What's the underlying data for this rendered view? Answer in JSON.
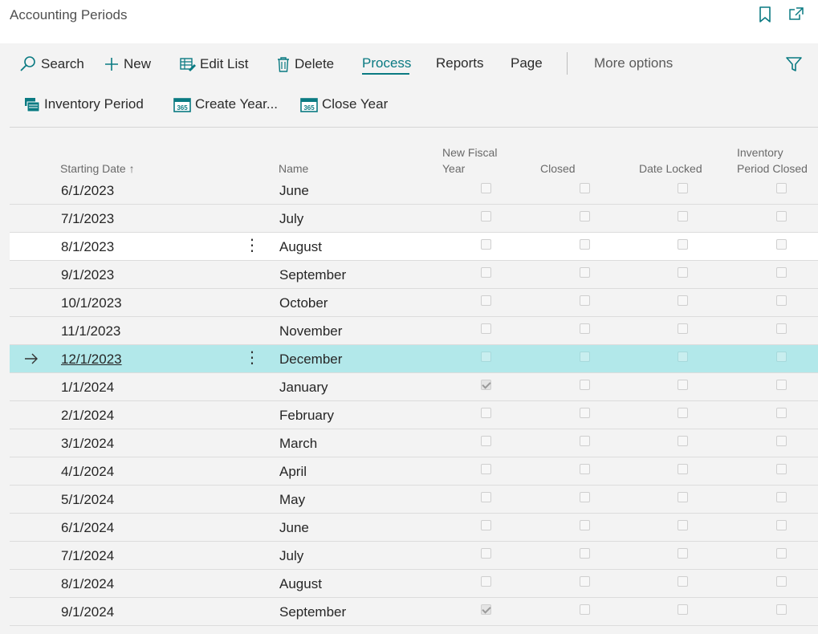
{
  "page": {
    "title": "Accounting Periods"
  },
  "toolbar": {
    "search": "Search",
    "new": "New",
    "edit_list": "Edit List",
    "delete": "Delete",
    "process": "Process",
    "reports": "Reports",
    "page": "Page",
    "more_options": "More options",
    "inventory_period": "Inventory Period",
    "create_year": "Create Year...",
    "close_year": "Close Year"
  },
  "table": {
    "columns": {
      "starting_date": "Starting Date",
      "sort_indicator": "↑",
      "name": "Name",
      "new_fiscal_year_l1": "New Fiscal",
      "new_fiscal_year_l2": "Year",
      "closed": "Closed",
      "date_locked": "Date Locked",
      "inventory_period_closed_l1": "Inventory",
      "inventory_period_closed_l2": "Period Closed"
    },
    "rows": [
      {
        "date": "6/1/2023",
        "name": "June",
        "new_fiscal_year": false,
        "closed": false,
        "date_locked": false,
        "inventory_closed": false
      },
      {
        "date": "7/1/2023",
        "name": "July",
        "new_fiscal_year": false,
        "closed": false,
        "date_locked": false,
        "inventory_closed": false
      },
      {
        "date": "8/1/2023",
        "name": "August",
        "new_fiscal_year": false,
        "closed": false,
        "date_locked": false,
        "inventory_closed": false,
        "hover": true
      },
      {
        "date": "9/1/2023",
        "name": "September",
        "new_fiscal_year": false,
        "closed": false,
        "date_locked": false,
        "inventory_closed": false
      },
      {
        "date": "10/1/2023",
        "name": "October",
        "new_fiscal_year": false,
        "closed": false,
        "date_locked": false,
        "inventory_closed": false
      },
      {
        "date": "11/1/2023",
        "name": "November",
        "new_fiscal_year": false,
        "closed": false,
        "date_locked": false,
        "inventory_closed": false
      },
      {
        "date": "12/1/2023",
        "name": "December",
        "new_fiscal_year": false,
        "closed": false,
        "date_locked": false,
        "inventory_closed": false,
        "selected": true
      },
      {
        "date": "1/1/2024",
        "name": "January",
        "new_fiscal_year": true,
        "closed": false,
        "date_locked": false,
        "inventory_closed": false
      },
      {
        "date": "2/1/2024",
        "name": "February",
        "new_fiscal_year": false,
        "closed": false,
        "date_locked": false,
        "inventory_closed": false
      },
      {
        "date": "3/1/2024",
        "name": "March",
        "new_fiscal_year": false,
        "closed": false,
        "date_locked": false,
        "inventory_closed": false
      },
      {
        "date": "4/1/2024",
        "name": "April",
        "new_fiscal_year": false,
        "closed": false,
        "date_locked": false,
        "inventory_closed": false
      },
      {
        "date": "5/1/2024",
        "name": "May",
        "new_fiscal_year": false,
        "closed": false,
        "date_locked": false,
        "inventory_closed": false
      },
      {
        "date": "6/1/2024",
        "name": "June",
        "new_fiscal_year": false,
        "closed": false,
        "date_locked": false,
        "inventory_closed": false
      },
      {
        "date": "7/1/2024",
        "name": "July",
        "new_fiscal_year": false,
        "closed": false,
        "date_locked": false,
        "inventory_closed": false
      },
      {
        "date": "8/1/2024",
        "name": "August",
        "new_fiscal_year": false,
        "closed": false,
        "date_locked": false,
        "inventory_closed": false
      },
      {
        "date": "9/1/2024",
        "name": "September",
        "new_fiscal_year": true,
        "closed": false,
        "date_locked": false,
        "inventory_closed": false
      }
    ]
  },
  "colors": {
    "accent": "#0a7a82",
    "selected_row": "#b2e8ea"
  }
}
